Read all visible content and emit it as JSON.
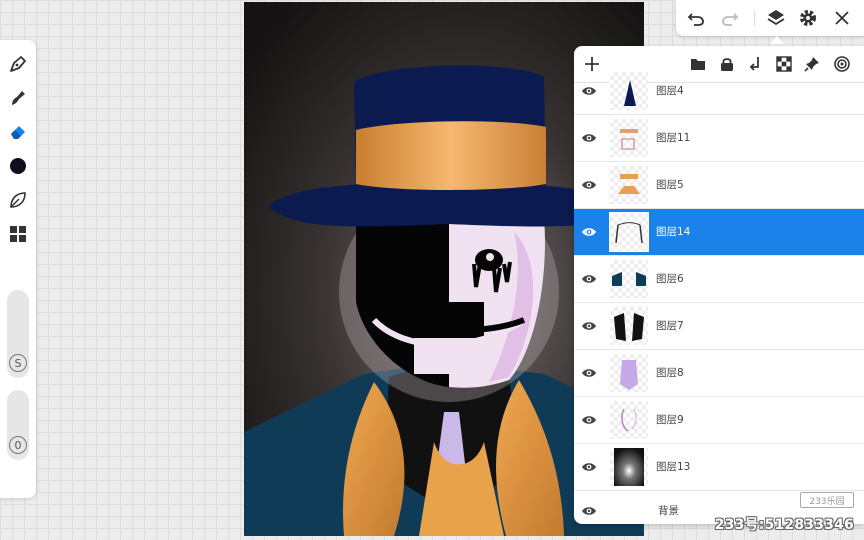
{
  "tools": [
    {
      "name": "pen-tool",
      "icon": "pen-nib-icon"
    },
    {
      "name": "smudge-tool",
      "icon": "smudge-icon"
    },
    {
      "name": "eraser-tool",
      "icon": "eraser-icon"
    },
    {
      "name": "color-swatch",
      "icon": "color-circle-icon",
      "color": "#0e1020"
    },
    {
      "name": "leaf-tool",
      "icon": "leaf-icon"
    },
    {
      "name": "grid-tool",
      "icon": "grid-icon"
    }
  ],
  "sliders": {
    "size_badge": "S",
    "opacity_badge": "0"
  },
  "topbar": {
    "icons": [
      "undo-icon",
      "redo-icon",
      "layers-icon",
      "gear-icon",
      "close-icon"
    ]
  },
  "layer_panel": {
    "header_icons": [
      "plus-icon",
      "folder-icon",
      "lock-icon",
      "merge-down-icon",
      "checker-icon",
      "pin-icon",
      "target-icon"
    ],
    "layers": [
      {
        "name": "图层4",
        "visible": true,
        "selected": false
      },
      {
        "name": "图层11",
        "visible": true,
        "selected": false
      },
      {
        "name": "图层5",
        "visible": true,
        "selected": false
      },
      {
        "name": "图层14",
        "visible": true,
        "selected": true
      },
      {
        "name": "图层6",
        "visible": true,
        "selected": false
      },
      {
        "name": "图层7",
        "visible": true,
        "selected": false
      },
      {
        "name": "图层8",
        "visible": true,
        "selected": false
      },
      {
        "name": "图层9",
        "visible": true,
        "selected": false
      },
      {
        "name": "图层13",
        "visible": true,
        "selected": false
      },
      {
        "name": "背景",
        "visible": true,
        "selected": false
      }
    ]
  },
  "colors": {
    "accent": "#1a82e8",
    "hat": "#0b1a4f",
    "band": "#e19a4a",
    "face_light": "#f2e8f2",
    "jacket": "#0f3b57"
  },
  "watermark": {
    "text": "233号:512833346",
    "logo": "233乐园"
  }
}
